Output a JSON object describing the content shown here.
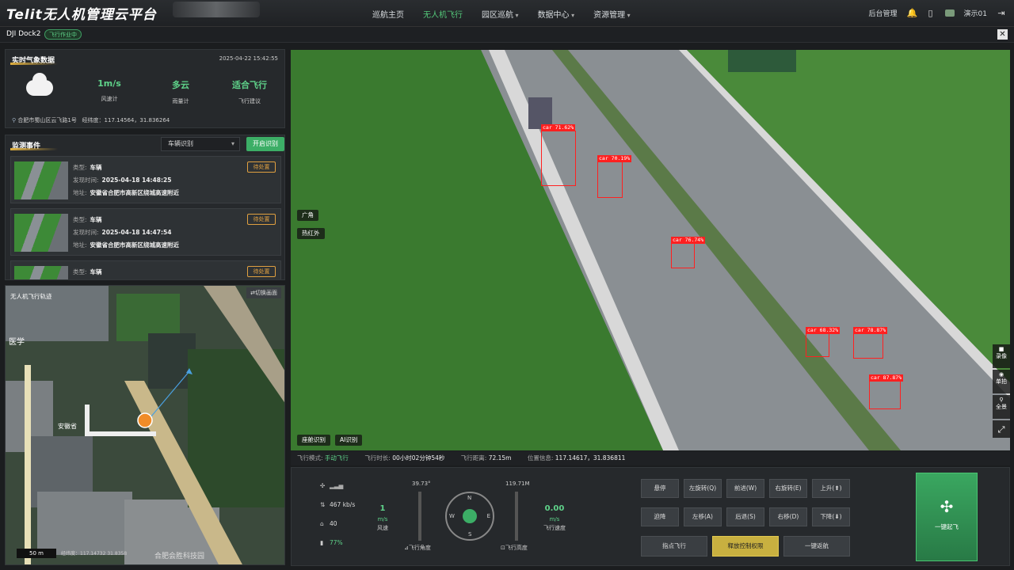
{
  "header": {
    "logo": "Telit无人机管理云平台",
    "nav": [
      {
        "label": "巡航主页",
        "active": false,
        "dropdown": false
      },
      {
        "label": "无人机飞行",
        "active": true,
        "dropdown": false
      },
      {
        "label": "园区巡航",
        "active": false,
        "dropdown": true
      },
      {
        "label": "数据中心",
        "active": false,
        "dropdown": true
      },
      {
        "label": "资源管理",
        "active": false,
        "dropdown": true
      }
    ],
    "admin_label": "后台管理",
    "user_name": "演示01",
    "icons": [
      "bell-icon",
      "phone-icon",
      "avatar",
      "logout-icon"
    ]
  },
  "subbar": {
    "dock_name": "DJI Dock2",
    "status_badge": "飞行作业中",
    "close_icon": "close-icon"
  },
  "weather": {
    "title": "实时气象数据",
    "timestamp": "2025-04-22 15:42:55",
    "icon": "cloud-icon",
    "wind_value": "1m/s",
    "wind_label": "风速计",
    "weather_value": "多云",
    "weather_label": "雨量计",
    "advice_value": "适合飞行",
    "advice_label": "飞行建议",
    "location": "合肥市蜀山区云飞路1号",
    "coords": "经纬度：117.14564，31.836264"
  },
  "monitor": {
    "title": "监测事件",
    "select_value": "车辆识别",
    "start_button": "开启识别",
    "type_label": "类型:",
    "time_label": "发现时间:",
    "addr_label": "地址:",
    "events": [
      {
        "type": "车辆",
        "time": "2025-04-18 14:48:25",
        "address": "安徽省合肥市高新区绕城高速附近",
        "status": "待处置"
      },
      {
        "type": "车辆",
        "time": "2025-04-18 14:47:54",
        "address": "安徽省合肥市高新区绕城高速附近",
        "status": "待处置"
      },
      {
        "type": "车辆",
        "time": "",
        "address": "",
        "status": "待处置"
      }
    ]
  },
  "map": {
    "title": "无人机飞行轨迹",
    "switch_button": "⇄切换画面",
    "scale": "50 m",
    "coords": "经纬度：117.14732 31.8358",
    "labels": [
      "安徽省",
      "合肥会胜科技园",
      "医学"
    ]
  },
  "video": {
    "lens_tags": [
      "广角",
      "热红外"
    ],
    "bottom_tags": [
      "座舱识别",
      "AI识别"
    ],
    "detections": [
      {
        "label": "car 71.62%",
        "color": "#ff2020"
      },
      {
        "label": "car 70.19%",
        "color": "#ff2020"
      },
      {
        "label": "car 76.74%",
        "color": "#ff2020"
      },
      {
        "label": "car 68.32%",
        "color": "#ff2020"
      },
      {
        "label": "car 78.87%",
        "color": "#ff2020"
      },
      {
        "label": "car 87.87%",
        "color": "#ff2020"
      }
    ],
    "side_buttons": [
      {
        "icon": "video-icon",
        "label": "录像"
      },
      {
        "icon": "camera-icon",
        "label": "单拍"
      },
      {
        "icon": "location-icon",
        "label": "全景"
      },
      {
        "icon": "fullscreen-icon",
        "label": ""
      }
    ]
  },
  "telemetry": {
    "mode_label": "飞行模式:",
    "mode_value": "手动飞行",
    "duration_label": "飞行时长:",
    "duration_value": "00小时02分钟54秒",
    "distance_label": "飞行距离:",
    "distance_value": "72.15m",
    "position_label": "位置信息:",
    "position_value": "117.14617，31.836811"
  },
  "control": {
    "signal_icon": "signal-icon",
    "bitrate": "467 kb/s",
    "satellites": "40",
    "battery": "77%",
    "wind_speed_value": "1",
    "wind_speed_unit": "m/s",
    "wind_speed_label": "风速",
    "angle_value": "39.73°",
    "angle_label": "飞行角度",
    "height_value": "119.71M",
    "height_label": "飞行高度",
    "flight_speed_value": "0.00",
    "flight_speed_unit": "m/s",
    "flight_speed_label": "飞行速度",
    "compass": {
      "n": "N",
      "s": "S",
      "e": "E",
      "w": "W"
    },
    "buttons_row1": [
      "悬停",
      "左旋转(Q)",
      "前进(W)",
      "右旋转(E)",
      "上升(⬆)"
    ],
    "buttons_row2": [
      "迫降",
      "左移(A)",
      "后退(S)",
      "右移(D)",
      "下降(⬇)"
    ],
    "wide_buttons": [
      "指点飞行",
      "释放控制权限",
      "一键返航"
    ],
    "takeoff_label": "一键起飞",
    "accent": "#5fd38a"
  }
}
